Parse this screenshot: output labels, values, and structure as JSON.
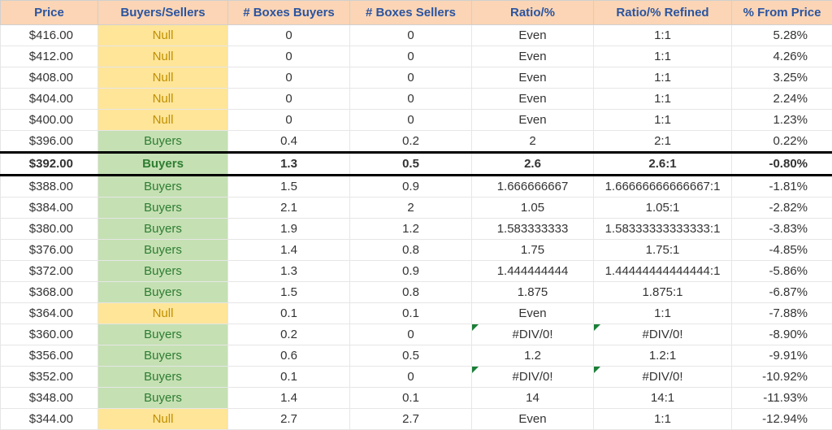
{
  "headers": {
    "price": "Price",
    "bs": "Buyers/Sellers",
    "bb": "# Boxes Buyers",
    "sb": "# Boxes Sellers",
    "ratio": "Ratio/%",
    "ratio2": "Ratio/% Refined",
    "pct": "% From Price"
  },
  "rows": [
    {
      "price": "$416.00",
      "bs": "Null",
      "bsClass": "null",
      "bb": "0",
      "sb": "0",
      "ratio": "Even",
      "ratio2": "1:1",
      "pct": "5.28%",
      "hl": false,
      "err": false
    },
    {
      "price": "$412.00",
      "bs": "Null",
      "bsClass": "null",
      "bb": "0",
      "sb": "0",
      "ratio": "Even",
      "ratio2": "1:1",
      "pct": "4.26%",
      "hl": false,
      "err": false
    },
    {
      "price": "$408.00",
      "bs": "Null",
      "bsClass": "null",
      "bb": "0",
      "sb": "0",
      "ratio": "Even",
      "ratio2": "1:1",
      "pct": "3.25%",
      "hl": false,
      "err": false
    },
    {
      "price": "$404.00",
      "bs": "Null",
      "bsClass": "null",
      "bb": "0",
      "sb": "0",
      "ratio": "Even",
      "ratio2": "1:1",
      "pct": "2.24%",
      "hl": false,
      "err": false
    },
    {
      "price": "$400.00",
      "bs": "Null",
      "bsClass": "null",
      "bb": "0",
      "sb": "0",
      "ratio": "Even",
      "ratio2": "1:1",
      "pct": "1.23%",
      "hl": false,
      "err": false
    },
    {
      "price": "$396.00",
      "bs": "Buyers",
      "bsClass": "buyers",
      "bb": "0.4",
      "sb": "0.2",
      "ratio": "2",
      "ratio2": "2:1",
      "pct": "0.22%",
      "hl": false,
      "err": false
    },
    {
      "price": "$392.00",
      "bs": "Buyers",
      "bsClass": "buyers",
      "bb": "1.3",
      "sb": "0.5",
      "ratio": "2.6",
      "ratio2": "2.6:1",
      "pct": "-0.80%",
      "hl": true,
      "err": false
    },
    {
      "price": "$388.00",
      "bs": "Buyers",
      "bsClass": "buyers",
      "bb": "1.5",
      "sb": "0.9",
      "ratio": "1.666666667",
      "ratio2": "1.66666666666667:1",
      "pct": "-1.81%",
      "hl": false,
      "err": false
    },
    {
      "price": "$384.00",
      "bs": "Buyers",
      "bsClass": "buyers",
      "bb": "2.1",
      "sb": "2",
      "ratio": "1.05",
      "ratio2": "1.05:1",
      "pct": "-2.82%",
      "hl": false,
      "err": false
    },
    {
      "price": "$380.00",
      "bs": "Buyers",
      "bsClass": "buyers",
      "bb": "1.9",
      "sb": "1.2",
      "ratio": "1.583333333",
      "ratio2": "1.58333333333333:1",
      "pct": "-3.83%",
      "hl": false,
      "err": false
    },
    {
      "price": "$376.00",
      "bs": "Buyers",
      "bsClass": "buyers",
      "bb": "1.4",
      "sb": "0.8",
      "ratio": "1.75",
      "ratio2": "1.75:1",
      "pct": "-4.85%",
      "hl": false,
      "err": false
    },
    {
      "price": "$372.00",
      "bs": "Buyers",
      "bsClass": "buyers",
      "bb": "1.3",
      "sb": "0.9",
      "ratio": "1.444444444",
      "ratio2": "1.44444444444444:1",
      "pct": "-5.86%",
      "hl": false,
      "err": false
    },
    {
      "price": "$368.00",
      "bs": "Buyers",
      "bsClass": "buyers",
      "bb": "1.5",
      "sb": "0.8",
      "ratio": "1.875",
      "ratio2": "1.875:1",
      "pct": "-6.87%",
      "hl": false,
      "err": false
    },
    {
      "price": "$364.00",
      "bs": "Null",
      "bsClass": "null",
      "bb": "0.1",
      "sb": "0.1",
      "ratio": "Even",
      "ratio2": "1:1",
      "pct": "-7.88%",
      "hl": false,
      "err": false
    },
    {
      "price": "$360.00",
      "bs": "Buyers",
      "bsClass": "buyers",
      "bb": "0.2",
      "sb": "0",
      "ratio": "#DIV/0!",
      "ratio2": "#DIV/0!",
      "pct": "-8.90%",
      "hl": false,
      "err": true
    },
    {
      "price": "$356.00",
      "bs": "Buyers",
      "bsClass": "buyers",
      "bb": "0.6",
      "sb": "0.5",
      "ratio": "1.2",
      "ratio2": "1.2:1",
      "pct": "-9.91%",
      "hl": false,
      "err": false
    },
    {
      "price": "$352.00",
      "bs": "Buyers",
      "bsClass": "buyers",
      "bb": "0.1",
      "sb": "0",
      "ratio": "#DIV/0!",
      "ratio2": "#DIV/0!",
      "pct": "-10.92%",
      "hl": false,
      "err": true
    },
    {
      "price": "$348.00",
      "bs": "Buyers",
      "bsClass": "buyers",
      "bb": "1.4",
      "sb": "0.1",
      "ratio": "14",
      "ratio2": "14:1",
      "pct": "-11.93%",
      "hl": false,
      "err": false
    },
    {
      "price": "$344.00",
      "bs": "Null",
      "bsClass": "null",
      "bb": "2.7",
      "sb": "2.7",
      "ratio": "Even",
      "ratio2": "1:1",
      "pct": "-12.94%",
      "hl": false,
      "err": false
    }
  ]
}
